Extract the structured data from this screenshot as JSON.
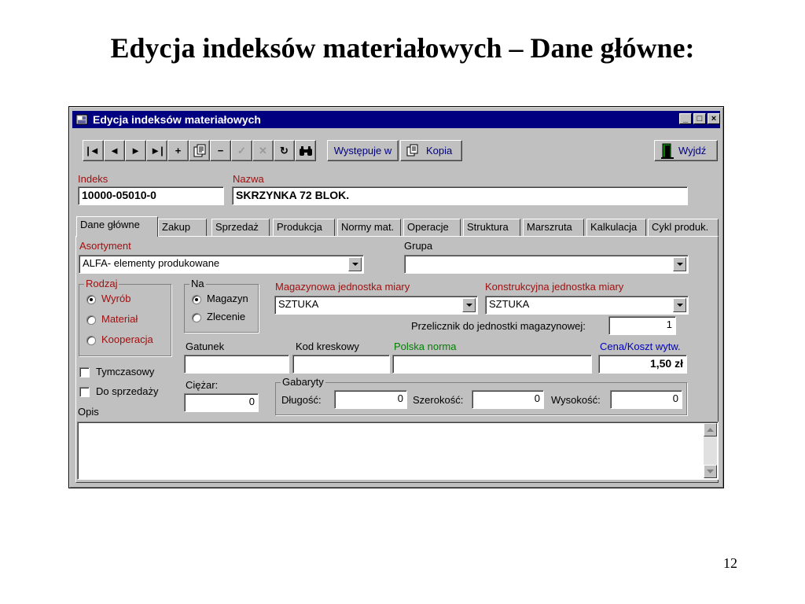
{
  "slide": {
    "title": "Edycja indeksów materiałowych – Dane główne:",
    "page_number": "12"
  },
  "window": {
    "title": "Edycja indeksów materiałowych",
    "minimize": "_",
    "maximize": "□",
    "close": "×"
  },
  "toolbar": {
    "nav": [
      "|◄",
      "◄",
      "►",
      "►|",
      "+",
      "",
      "−",
      "✓",
      "✕",
      "↻",
      ""
    ],
    "wystepuje_w": "Występuje w",
    "kopia": "Kopia",
    "wyjdz": "Wyjdź"
  },
  "header": {
    "indeks_label": "Indeks",
    "indeks_value": "10000-05010-0",
    "nazwa_label": "Nazwa",
    "nazwa_value": "SKRZYNKA 72 BLOK."
  },
  "tabs": [
    "Dane główne",
    "Zakup",
    "Sprzedaż",
    "Produkcja",
    "Normy mat.",
    "Operacje",
    "Struktura",
    "Marszruta",
    "Kalkulacja",
    "Cykl produk."
  ],
  "form": {
    "asortyment_label": "Asortyment",
    "asortyment_value": "ALFA- elementy produkowane",
    "grupa_label": "Grupa",
    "grupa_value": "",
    "rodzaj_label": "Rodzaj",
    "rodzaj_options": [
      "Wyrób",
      "Materiał",
      "Kooperacja"
    ],
    "rodzaj_selected": "Wyrób",
    "na_label": "Na",
    "na_options": [
      "Magazyn",
      "Zlecenie"
    ],
    "na_selected": "Magazyn",
    "mag_jm_label": "Magazynowa jednostka miary",
    "mag_jm_value": "SZTUKA",
    "konstr_jm_label": "Konstrukcyjna jednostka miary",
    "konstr_jm_value": "SZTUKA",
    "przelicznik_label": "Przelicznik do jednostki magazynowej:",
    "przelicznik_value": "1",
    "gatunek_label": "Gatunek",
    "gatunek_value": "",
    "kod_label": "Kod kreskowy",
    "kod_value": "",
    "norma_label": "Polska norma",
    "norma_value": "",
    "cena_label": "Cena/Koszt wytw.",
    "cena_value": "1,50 zł",
    "tymczasowy_label": "Tymczasowy",
    "tymczasowy_checked": false,
    "do_sprzedazy_label": "Do sprzedaży",
    "do_sprzedazy_checked": false,
    "ciezar_label": "Ciężar:",
    "ciezar_value": "0",
    "gabaryty_label": "Gabaryty",
    "dlugosc_label": "Długość:",
    "dlugosc_value": "0",
    "szerokosc_label": "Szerokość:",
    "szerokosc_value": "0",
    "wysokosc_label": "Wysokość:",
    "wysokosc_value": "0",
    "opis_label": "Opis",
    "opis_value": ""
  },
  "colors": {
    "window_bg": "#c0c0c0",
    "title_bar": "#000080",
    "label_red": "#a01010",
    "label_green": "#008000",
    "label_blue": "#0000c0"
  },
  "icons": [
    "app-icon",
    "first-record-icon",
    "prev-record-icon",
    "next-record-icon",
    "last-record-icon",
    "add-icon",
    "edit-icon",
    "delete-icon",
    "confirm-icon",
    "cancel-icon",
    "refresh-icon",
    "binoculars-icon",
    "copy-icon",
    "exit-door-icon"
  ]
}
